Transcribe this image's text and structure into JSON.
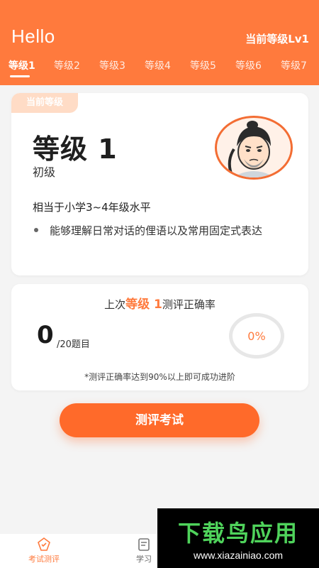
{
  "header": {
    "greeting": "Hello",
    "current_level": "当前等级Lv1",
    "tabs": [
      "等级1",
      "等级2",
      "等级3",
      "等级4",
      "等级5",
      "等级6",
      "等级7"
    ],
    "active_tab": 0
  },
  "level_card": {
    "badge": "当前等级",
    "title": "等级 1",
    "subtitle": "初级",
    "equivalent": "相当于小学3~4年级水平",
    "bullet": "能够理解日常对话的俚语以及常用固定式表达"
  },
  "score_card": {
    "title_prefix": "上次",
    "title_highlight": "等级 1",
    "title_suffix": "测评正确率",
    "score": "0",
    "score_unit": "/20题目",
    "percent": "0%",
    "note": "*测评正确率达到90%以上即可成功进阶"
  },
  "actions": {
    "exam_button": "测评考试"
  },
  "bottom_nav": {
    "items": [
      "考试测评",
      "学习"
    ],
    "active": 0
  },
  "watermark": {
    "main": "下载鸟应用",
    "url": "www.xiazainiao.com"
  },
  "colors": {
    "accent": "#ff7a3d",
    "button": "#ff6a2a",
    "background": "#f4f4f4"
  }
}
